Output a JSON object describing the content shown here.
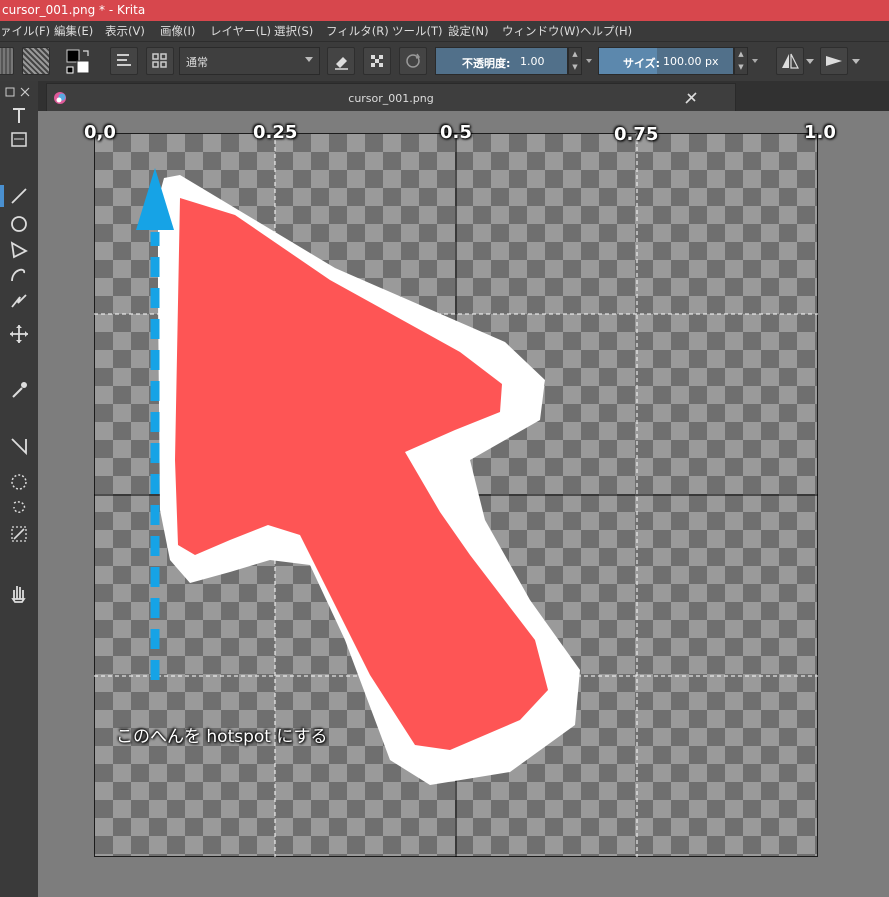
{
  "window": {
    "title": "cursor_001.png * - Krita"
  },
  "menu": [
    "ァイル(F)",
    "編集(E)",
    "表示(V)",
    "画像(I)",
    "レイヤー(L)",
    "選択(S)",
    "フィルタ(R)",
    "ツール(T)",
    "設定(N)",
    "ウィンドウ(W)",
    "ヘルプ(H)"
  ],
  "toolbar": {
    "blend_mode": "通常",
    "opacity_label": "不透明度:",
    "opacity_value": "1.00",
    "size_label": "サイズ:",
    "size_value": "100.00 px"
  },
  "document": {
    "tab_title": "cursor_001.png"
  },
  "canvas": {
    "ruler_labels": [
      "0,0",
      "0.25",
      "0.5",
      "0.75",
      "1.0"
    ],
    "annotation": "このへんを hotspot にする"
  },
  "colors": {
    "cursor_fill": "#fe5555",
    "cursor_outline": "#ffffff",
    "arrow": "#16a3e6",
    "titlebar": "#d7474d"
  },
  "icons": [
    "brush-preset-icon",
    "pattern-icon",
    "color-swap-icon",
    "preset-list-icon",
    "grid-icon",
    "eraser-icon",
    "alpha-lock-icon",
    "reload-icon",
    "mirror-h-icon",
    "mirror-v-icon"
  ]
}
